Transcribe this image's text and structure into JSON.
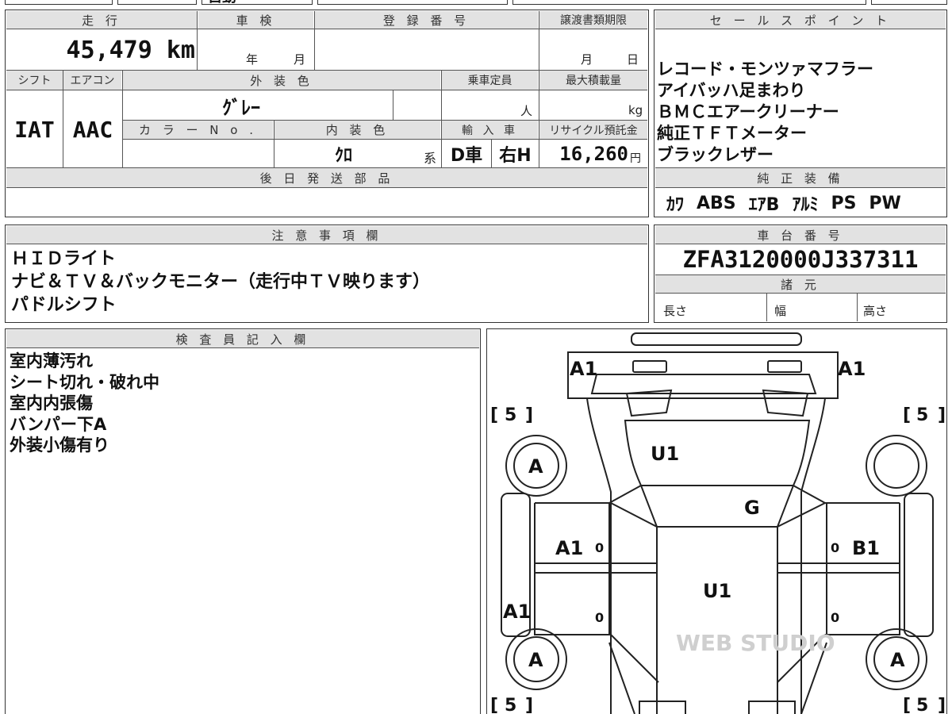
{
  "top_strip": {
    "text": "自動"
  },
  "main": {
    "mileage": {
      "label": "走 行",
      "value": "45,479 km"
    },
    "shaken": {
      "label": "車 検",
      "year": "年",
      "month": "月"
    },
    "registration": {
      "label": "登 録 番 号"
    },
    "transfer": {
      "label": "譲渡書類期限",
      "month": "月",
      "day": "日"
    },
    "shift": {
      "label": "シフト",
      "value": "IAT"
    },
    "aircon": {
      "label": "エアコン",
      "value": "AAC"
    },
    "exterior": {
      "label": "外 装 色",
      "value": "ｸﾞﾚｰ"
    },
    "capacity": {
      "label": "乗車定員",
      "unit": "人"
    },
    "max_load": {
      "label": "最大積載量",
      "unit": "kg"
    },
    "color_no": {
      "label": "カ ラ ー N o ."
    },
    "interior": {
      "label": "内 装 色",
      "value": "ｸﾛ",
      "suffix": "系"
    },
    "import": {
      "label": "輸 入 車",
      "value1": "D車",
      "value2": "右H"
    },
    "recycle": {
      "label": "リサイクル預託金",
      "value": "16,260",
      "unit": "円"
    },
    "later_parts": {
      "label": "後 日 発 送 部 品"
    }
  },
  "sales_points": {
    "label": "セ ー ル ス ポ イ ン ト",
    "items": [
      "レコード・モンツァマフラー",
      "アイバッハ足まわり",
      "ＢＭＣエアークリーナー",
      "純正ＴＦＴメーター",
      "ブラックレザー"
    ]
  },
  "equipment": {
    "label": "純 正 装 備",
    "items": [
      "ｶﾜ",
      "ABS",
      "ｴｱB",
      "ｱﾙﾐ",
      "PS",
      "PW"
    ]
  },
  "notes": {
    "label": "注 意 事 項 欄",
    "items": [
      "ＨＩＤライト",
      "ナビ＆ＴＶ＆バックモニター（走行中ＴＶ映ります）",
      "パドルシフト"
    ]
  },
  "chassis": {
    "label": "車 台 番 号",
    "value": "ZFA3120000J337311"
  },
  "specs": {
    "label": "諸 元",
    "length": "長さ",
    "width": "幅",
    "height": "高さ"
  },
  "inspector": {
    "label": "検 査 員 記 入 欄",
    "items": [
      "室内薄汚れ",
      "シート切れ・破れ中",
      "室内内張傷",
      "バンパー下A",
      "外装小傷有り"
    ]
  },
  "diagram": {
    "marks": {
      "a1_front_left": "A1",
      "a1_front_right": "A1",
      "five": "5",
      "u1_glass": "U1",
      "g_roof": "G",
      "a_wheel": "A",
      "a1_door": "A1",
      "b1_door": "B1",
      "u1_floor": "U1",
      "a1_side": "A1",
      "zero": "0"
    },
    "watermark": "WEB STUDIO"
  }
}
